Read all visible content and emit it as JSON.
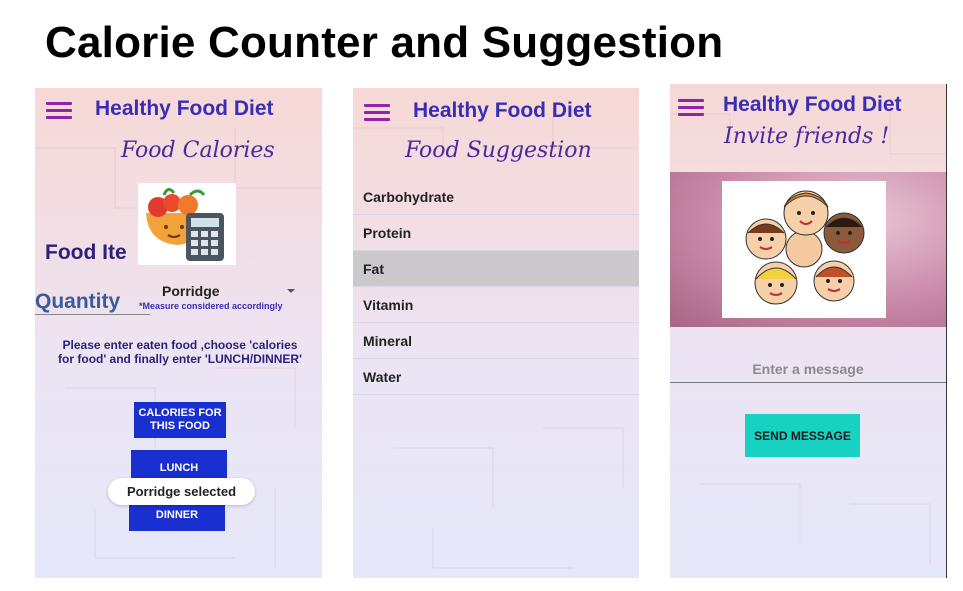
{
  "slide": {
    "title": "Calorie Counter and Suggestion"
  },
  "app": {
    "title": "Healthy Food Diet"
  },
  "screen1": {
    "subtitle": "Food Calories",
    "food_item_label": "Food Ite",
    "spinner_value": "Porridge",
    "quantity_label": "Quantity",
    "measure_note": "*Measure considered accordingly",
    "instructions": "Please enter eaten food ,choose 'calories for food' and finally enter 'LUNCH/DINNER'",
    "calories_button": "CALORIES FOR THIS FOOD",
    "lunch_button": "LUNCH",
    "dinner_button": "DINNER",
    "toast": "Porridge selected"
  },
  "screen2": {
    "subtitle": "Food Suggestion",
    "items": [
      {
        "label": "Carbohydrate"
      },
      {
        "label": "Protein"
      },
      {
        "label": "Fat"
      },
      {
        "label": "Vitamin"
      },
      {
        "label": "Mineral"
      },
      {
        "label": "Water"
      }
    ],
    "selected": "Fat"
  },
  "screen3": {
    "subtitle": "Invite friends !",
    "message_placeholder": "Enter a message",
    "send_button": "SEND MESSAGE"
  },
  "icons": {
    "menu": "hamburger-menu-icon",
    "food": "food-calculator-icon",
    "kids": "friends-group-illustration"
  },
  "colors": {
    "title_blue": "#3a2db5",
    "button_blue": "#1a2fd0",
    "send_teal": "#17d2c0",
    "menu_purple": "#8e24aa"
  }
}
